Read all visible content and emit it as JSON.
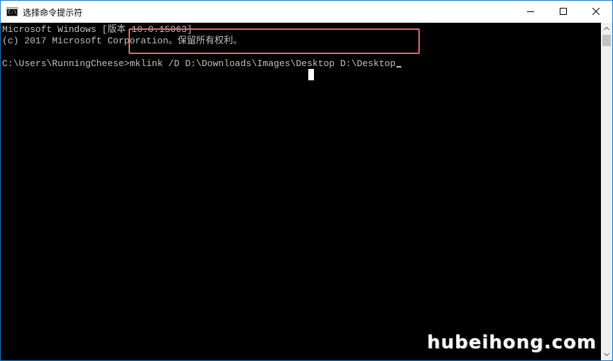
{
  "window": {
    "title": "选择命令提示符",
    "icon": "cmd-icon",
    "icon_text": "C:\\",
    "controls": {
      "minimize": "minimize-icon",
      "maximize": "maximize-icon",
      "close": "close-icon"
    },
    "border_color": "#1979ca"
  },
  "console": {
    "lines": [
      "Microsoft Windows [版本 10.0.15063]",
      "(c) 2017 Microsoft Corporation。保留所有权利。"
    ],
    "prompt": "C:\\Users\\RunningCheese>",
    "command": "mklink /D D:\\Downloads\\Images\\Desktop D:\\Desktop",
    "text_color": "#c0c0c0",
    "background": "#000000"
  },
  "annotation": {
    "highlight_color": "#e06a72"
  },
  "watermark": "hubeihong.com"
}
